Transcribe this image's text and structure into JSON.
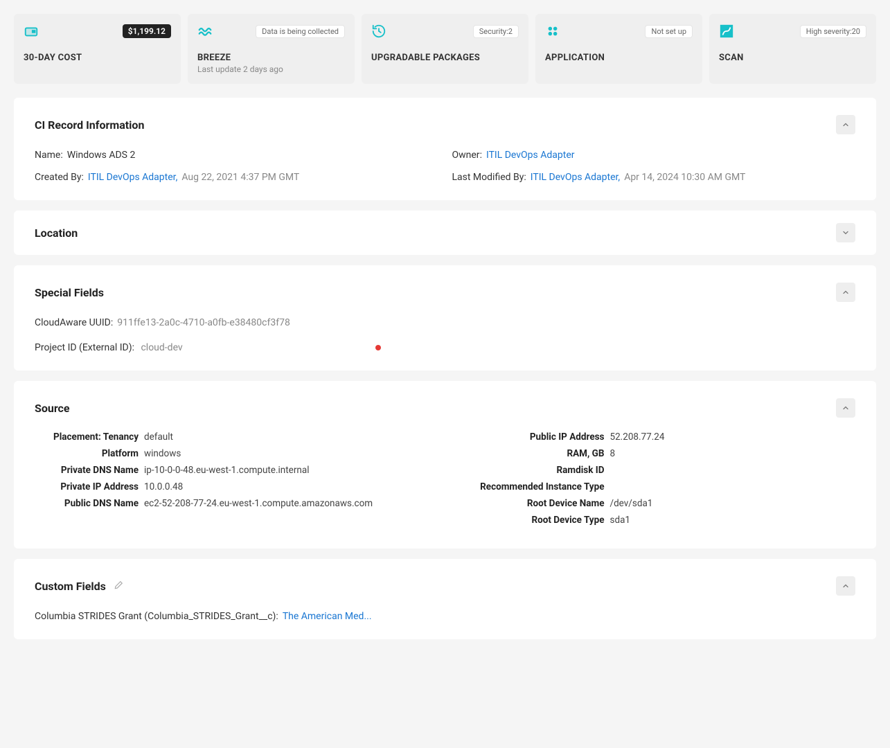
{
  "cards": {
    "cost": {
      "title": "30-DAY COST",
      "badge": "$1,199.12"
    },
    "breeze": {
      "title": "BREEZE",
      "badge": "Data is being collected",
      "sub": "Last update 2 days ago"
    },
    "pkgs": {
      "title": "UPGRADABLE PACKAGES",
      "badge": "Security:2"
    },
    "app": {
      "title": "APPLICATION",
      "badge": "Not set up"
    },
    "scan": {
      "title": "SCAN",
      "badge": "High severity:20"
    }
  },
  "panels": {
    "ci": {
      "title": "CI Record Information",
      "name_label": "Name",
      "name_value": "Windows ADS 2",
      "owner_label": "Owner",
      "owner_value": "ITIL DevOps Adapter",
      "created_label": "Created By",
      "created_user": "ITIL DevOps Adapter,",
      "created_date": "Aug 22, 2021 4:37 PM GMT",
      "modified_label": "Last Modified By",
      "modified_user": "ITIL DevOps Adapter,",
      "modified_date": "Apr 14, 2024 10:30 AM GMT"
    },
    "location": {
      "title": "Location"
    },
    "special": {
      "title": "Special Fields",
      "uuid_label": "CloudAware UUID",
      "uuid_value": "911ffe13-2a0c-4710-a0fb-e38480cf3f78",
      "pid_label": "Project ID (External ID)",
      "pid_value": "cloud-dev"
    },
    "source": {
      "title": "Source",
      "left": {
        "placement_label": "Placement: Tenancy",
        "placement_value": "default",
        "platform_label": "Platform",
        "platform_value": "windows",
        "privdns_label": "Private DNS Name",
        "privdns_value": "ip-10-0-0-48.eu-west-1.compute.internal",
        "privip_label": "Private IP Address",
        "privip_value": "10.0.0.48",
        "pubdns_label": "Public DNS Name",
        "pubdns_value": "ec2-52-208-77-24.eu-west-1.compute.amazonaws.com"
      },
      "right": {
        "pubip_label": "Public IP Address",
        "pubip_value": "52.208.77.24",
        "ram_label": "RAM, GB",
        "ram_value": "8",
        "ramdisk_label": "Ramdisk ID",
        "ramdisk_value": "",
        "rectype_label": "Recommended Instance Type",
        "rectype_value": "",
        "rootname_label": "Root Device Name",
        "rootname_value": "/dev/sda1",
        "roottype_label": "Root Device Type",
        "roottype_value": "sda1"
      }
    },
    "custom": {
      "title": "Custom Fields",
      "grant_label": "Columbia STRIDES Grant (Columbia_STRIDES_Grant__c)",
      "grant_value": "The American Med..."
    }
  }
}
